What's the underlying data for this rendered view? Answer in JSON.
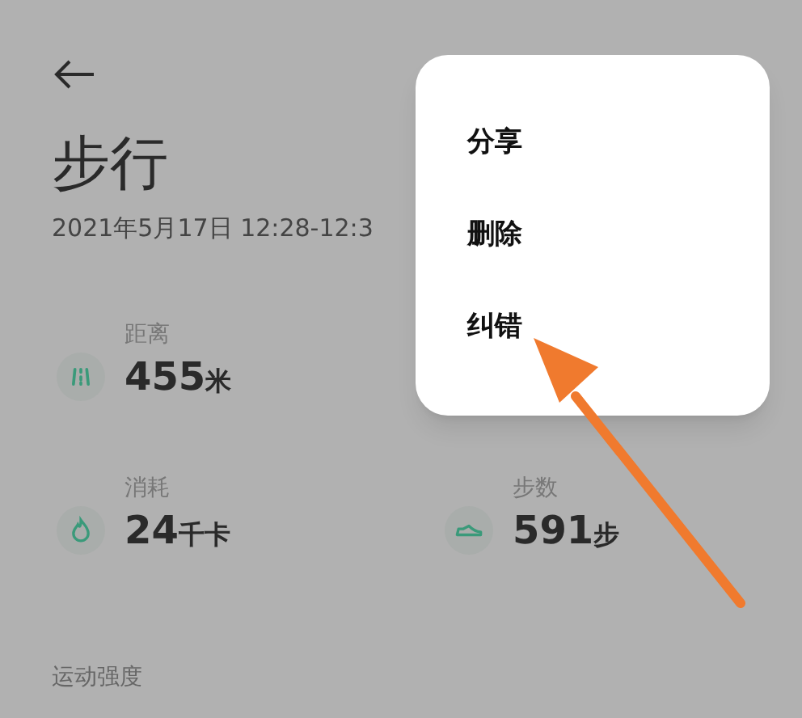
{
  "title": "步行",
  "date": "2021年5月17日 12:28-12:3",
  "stats": [
    {
      "kind": "distance",
      "label": "距离",
      "value": "455",
      "unit": "米"
    },
    {
      "kind": "calories",
      "label": "消耗",
      "value": "24",
      "unit": "千卡"
    },
    {
      "kind": "steps",
      "label": "步数",
      "value": "591",
      "unit": "步"
    }
  ],
  "section_label": "运动强度",
  "menu": {
    "items": [
      "分享",
      "删除",
      "纠错"
    ]
  }
}
